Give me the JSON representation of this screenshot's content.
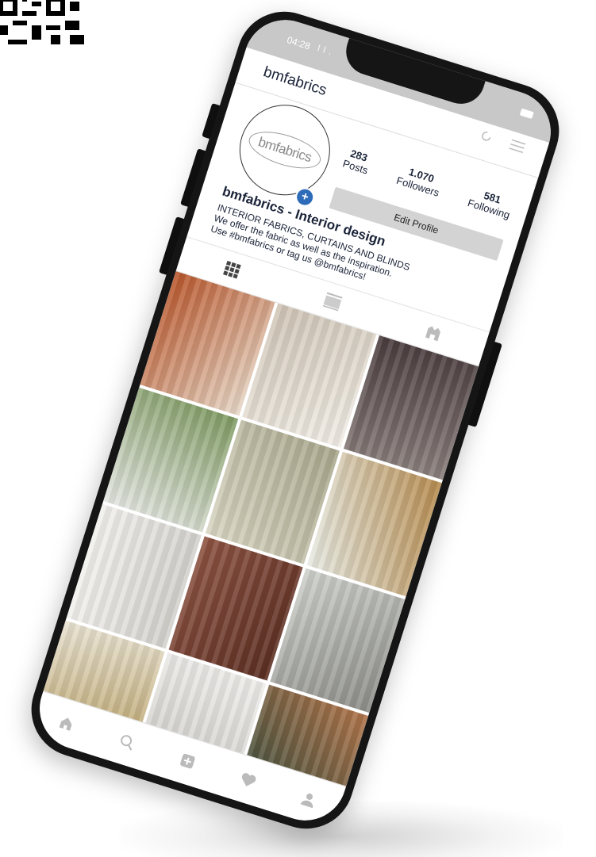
{
  "status_bar": {
    "time": "04:28",
    "signal": "l l ."
  },
  "profile": {
    "username": "bmfabrics",
    "avatar_logo": "bmfabrics",
    "display_name": "bmfabrics - Interior design",
    "bio": [
      "INTERIOR FABRICS, CURTAINS AND BLINDS",
      "We offer the fabric as well as the inspiration.",
      "Use #bmfabrics or tag us @bmfabrics!"
    ]
  },
  "stats": [
    {
      "value": "283",
      "label": "Posts"
    },
    {
      "value": "1.070",
      "label": "Followers"
    },
    {
      "value": "581",
      "label": "Following"
    }
  ],
  "edit_profile_label": "Edit Profile",
  "tabs": [
    "grid-icon",
    "feed-icon",
    "tagged-icon"
  ],
  "posts": [
    {
      "name": "post-orange-cushions",
      "c1": "#b8552a",
      "c2": "#e7d8c8"
    },
    {
      "name": "post-folded-fabrics",
      "c1": "#cfc4b5",
      "c2": "#f1ede6"
    },
    {
      "name": "post-dark-curtain",
      "c1": "#4a3c3e",
      "c2": "#8a7f7c"
    },
    {
      "name": "post-sheer-window",
      "c1": "#7f9a62",
      "c2": "#e4e6e2"
    },
    {
      "name": "post-linen-closeup",
      "c1": "#a8a78c",
      "c2": "#d8d5c2"
    },
    {
      "name": "post-rattan-chair",
      "c1": "#b58a4d",
      "c2": "#e7ebe4"
    },
    {
      "name": "post-white-living-room",
      "c1": "#d3d1cc",
      "c2": "#f2f1ee"
    },
    {
      "name": "post-brown-velvet",
      "c1": "#5b2e22",
      "c2": "#8e5443"
    },
    {
      "name": "post-grey-sheer",
      "c1": "#8c8d88",
      "c2": "#cfd1cc"
    },
    {
      "name": "post-golden-curtain",
      "c1": "#b49a5c",
      "c2": "#e8e2d2"
    },
    {
      "name": "post-white-sheer",
      "c1": "#cccbc6",
      "c2": "#eeedea"
    },
    {
      "name": "post-green-copper",
      "c1": "#2f4a3c",
      "c2": "#b0744a"
    }
  ],
  "bottom_nav": [
    "home-icon",
    "search-icon",
    "add-post-icon",
    "heart-icon",
    "profile-icon"
  ],
  "colors": {
    "phone_frame": "#151515",
    "status_bar": "#c8c8c8",
    "text_dark": "#1a2338",
    "badge_blue": "#2e6bb8",
    "button_grey": "#d3d3d3"
  }
}
